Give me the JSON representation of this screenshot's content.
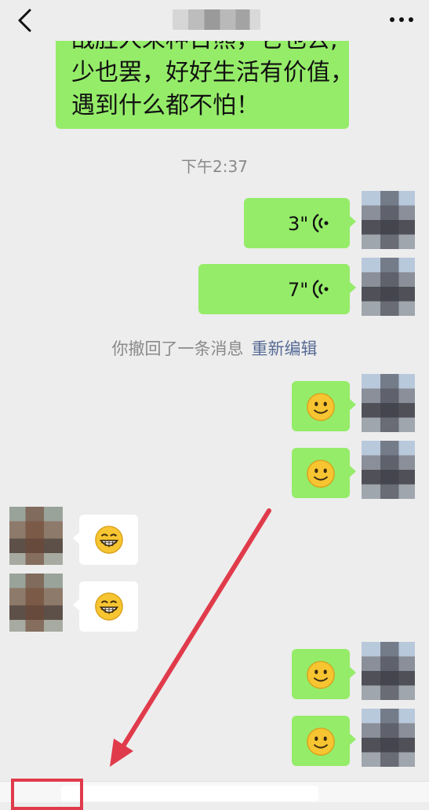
{
  "header": {
    "back_icon": "chevron-left-icon",
    "title": "",
    "more_icon": "more-horizontal-icon"
  },
  "messages": {
    "text_lines": [
      "战胜人来种日熊，它也去,",
      "少也罢，好好生活有价值，",
      "遇到什么都不怕！"
    ],
    "timestamp": "下午2:37",
    "voice": [
      {
        "duration": "3\""
      },
      {
        "duration": "7\""
      }
    ],
    "recall_notice": "你撤回了一条消息",
    "recall_edit_link": "重新编辑",
    "sent_emoji": "smile-emoji-icon",
    "received_emoji": "grin-emoji-icon"
  },
  "colors": {
    "sent_bubble": "#95ec69",
    "received_bubble": "#ffffff",
    "annotation": "#e03b4b",
    "link": "#576b95"
  }
}
